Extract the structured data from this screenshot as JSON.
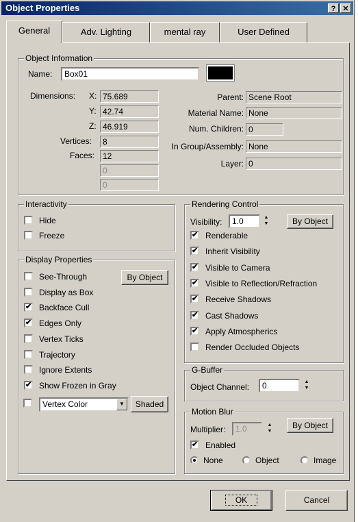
{
  "window": {
    "title": "Object Properties",
    "help_label": "?",
    "close_label": "✕"
  },
  "tabs": [
    "General",
    "Adv. Lighting",
    "mental ray",
    "User Defined"
  ],
  "object_info": {
    "title": "Object Information",
    "name_label": "Name:",
    "name_value": "Box01",
    "dimensions_label": "Dimensions:",
    "x_label": "X:",
    "x_value": "75.689",
    "y_label": "Y:",
    "y_value": "42.74",
    "z_label": "Z:",
    "z_value": "46.919",
    "vertices_label": "Vertices:",
    "vertices_value": "8",
    "faces_label": "Faces:",
    "faces_value": "12",
    "extra1_value": "0",
    "extra2_value": "0",
    "parent_label": "Parent:",
    "parent_value": "Scene Root",
    "material_label": "Material Name:",
    "material_value": "None",
    "children_label": "Num. Children:",
    "children_value": "0",
    "group_label": "In Group/Assembly:",
    "group_value": "None",
    "layer_label": "Layer:",
    "layer_value": "0",
    "color_swatch": "#000000"
  },
  "interactivity": {
    "title": "Interactivity",
    "items": [
      {
        "label": "Hide",
        "checked": false
      },
      {
        "label": "Freeze",
        "checked": false
      }
    ]
  },
  "display_properties": {
    "title": "Display Properties",
    "by_object_label": "By Object",
    "items": [
      {
        "label": "See-Through",
        "checked": false
      },
      {
        "label": "Display as Box",
        "checked": false
      },
      {
        "label": "Backface Cull",
        "checked": true
      },
      {
        "label": "Edges Only",
        "checked": true
      },
      {
        "label": "Vertex Ticks",
        "checked": false
      },
      {
        "label": "Trajectory",
        "checked": false
      },
      {
        "label": "Ignore Extents",
        "checked": false
      },
      {
        "label": "Show Frozen in Gray",
        "checked": true
      }
    ],
    "vertex_color_checked": false,
    "vertex_color_value": "Vertex Color",
    "shaded_label": "Shaded"
  },
  "rendering_control": {
    "title": "Rendering Control",
    "visibility_label": "Visibility:",
    "visibility_value": "1.0",
    "by_object_label": "By Object",
    "items": [
      {
        "label": "Renderable",
        "checked": true
      },
      {
        "label": "Inherit Visibility",
        "checked": true
      },
      {
        "label": "Visible to Camera",
        "checked": true
      },
      {
        "label": "Visible to Reflection/Refraction",
        "checked": true
      },
      {
        "label": "Receive Shadows",
        "checked": true
      },
      {
        "label": "Cast Shadows",
        "checked": true
      },
      {
        "label": "Apply Atmospherics",
        "checked": true
      },
      {
        "label": "Render Occluded Objects",
        "checked": false
      }
    ]
  },
  "gbuffer": {
    "title": "G-Buffer",
    "channel_label": "Object Channel:",
    "channel_value": "0"
  },
  "motion_blur": {
    "title": "Motion Blur",
    "multiplier_label": "Multiplier:",
    "multiplier_value": "1.0",
    "by_object_label": "By Object",
    "enabled_label": "Enabled",
    "enabled_checked": true,
    "options": [
      {
        "label": "None",
        "selected": true
      },
      {
        "label": "Object",
        "selected": false
      },
      {
        "label": "Image",
        "selected": false
      }
    ]
  },
  "footer": {
    "ok_label": "OK",
    "cancel_label": "Cancel"
  }
}
